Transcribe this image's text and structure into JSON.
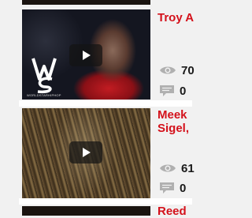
{
  "videos": [
    {
      "title_lines": [
        "Troy A"
      ],
      "views": "70",
      "comments": "0"
    },
    {
      "title_lines": [
        "Meek",
        "Sigel,"
      ],
      "views": "61",
      "comments": "0"
    },
    {
      "title_lines": [
        "Reed"
      ]
    }
  ],
  "watermark": {
    "brand_text": "WORLDSTARHIPHOP"
  },
  "icons": [
    "eye-icon",
    "comment-icon",
    "play-icon"
  ],
  "colors": {
    "title": "#d4111b",
    "background": "#f1f1f1"
  }
}
